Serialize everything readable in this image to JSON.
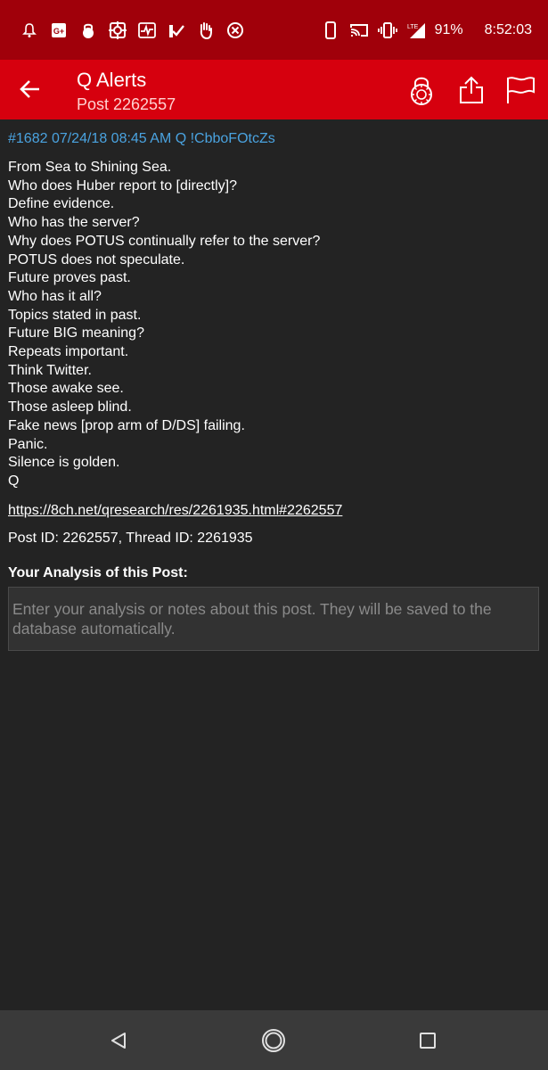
{
  "status_bar": {
    "icons": [
      "notification-bell-icon",
      "google-plus-icon",
      "lock-icon",
      "target-icon",
      "pulse-icon",
      "check-flag-icon",
      "hand-icon",
      "cancel-circle-icon"
    ],
    "right_icons": [
      "phone-icon",
      "cast-icon",
      "vibrate-icon",
      "lte-signal-icon"
    ],
    "battery": "91%",
    "time": "8:52:03"
  },
  "app_bar": {
    "title": "Q Alerts",
    "subtitle": "Post 2262557",
    "actions": [
      "lock-icon",
      "share-icon",
      "flag-icon"
    ]
  },
  "post": {
    "header": "#1682 07/24/18 08:45 AM Q !CbboFOtcZs",
    "lines": [
      "From Sea to Shining Sea.",
      "Who does Huber report to [directly]?",
      "Define evidence.",
      "Who has the server?",
      "Why does POTUS continually refer to the server?",
      "POTUS does not speculate.",
      "Future proves past.",
      "Who has it all?",
      "Topics stated in past.",
      "Future BIG meaning?",
      "Repeats important.",
      "Think Twitter.",
      "Those awake see.",
      "Those asleep blind.",
      "Fake news [prop arm of D/DS] failing.",
      "Panic.",
      "Silence is golden.",
      "Q"
    ],
    "link": "https://8ch.net/qresearch/res/2261935.html#2262557",
    "ids": "Post ID: 2262557, Thread ID: 2261935"
  },
  "analysis": {
    "label": "Your Analysis of this Post:",
    "value": "",
    "placeholder": "Enter your analysis or notes about this post. They will be saved to the database automatically."
  },
  "nav_bar": {
    "buttons": [
      "back-triangle-icon",
      "home-circle-icon",
      "recents-square-icon"
    ]
  },
  "colors": {
    "status_bar": "#a0000a",
    "app_bar": "#d6000e",
    "background": "#232323",
    "header_link": "#4aa3e0",
    "nav_bar": "#3a3a3a"
  }
}
